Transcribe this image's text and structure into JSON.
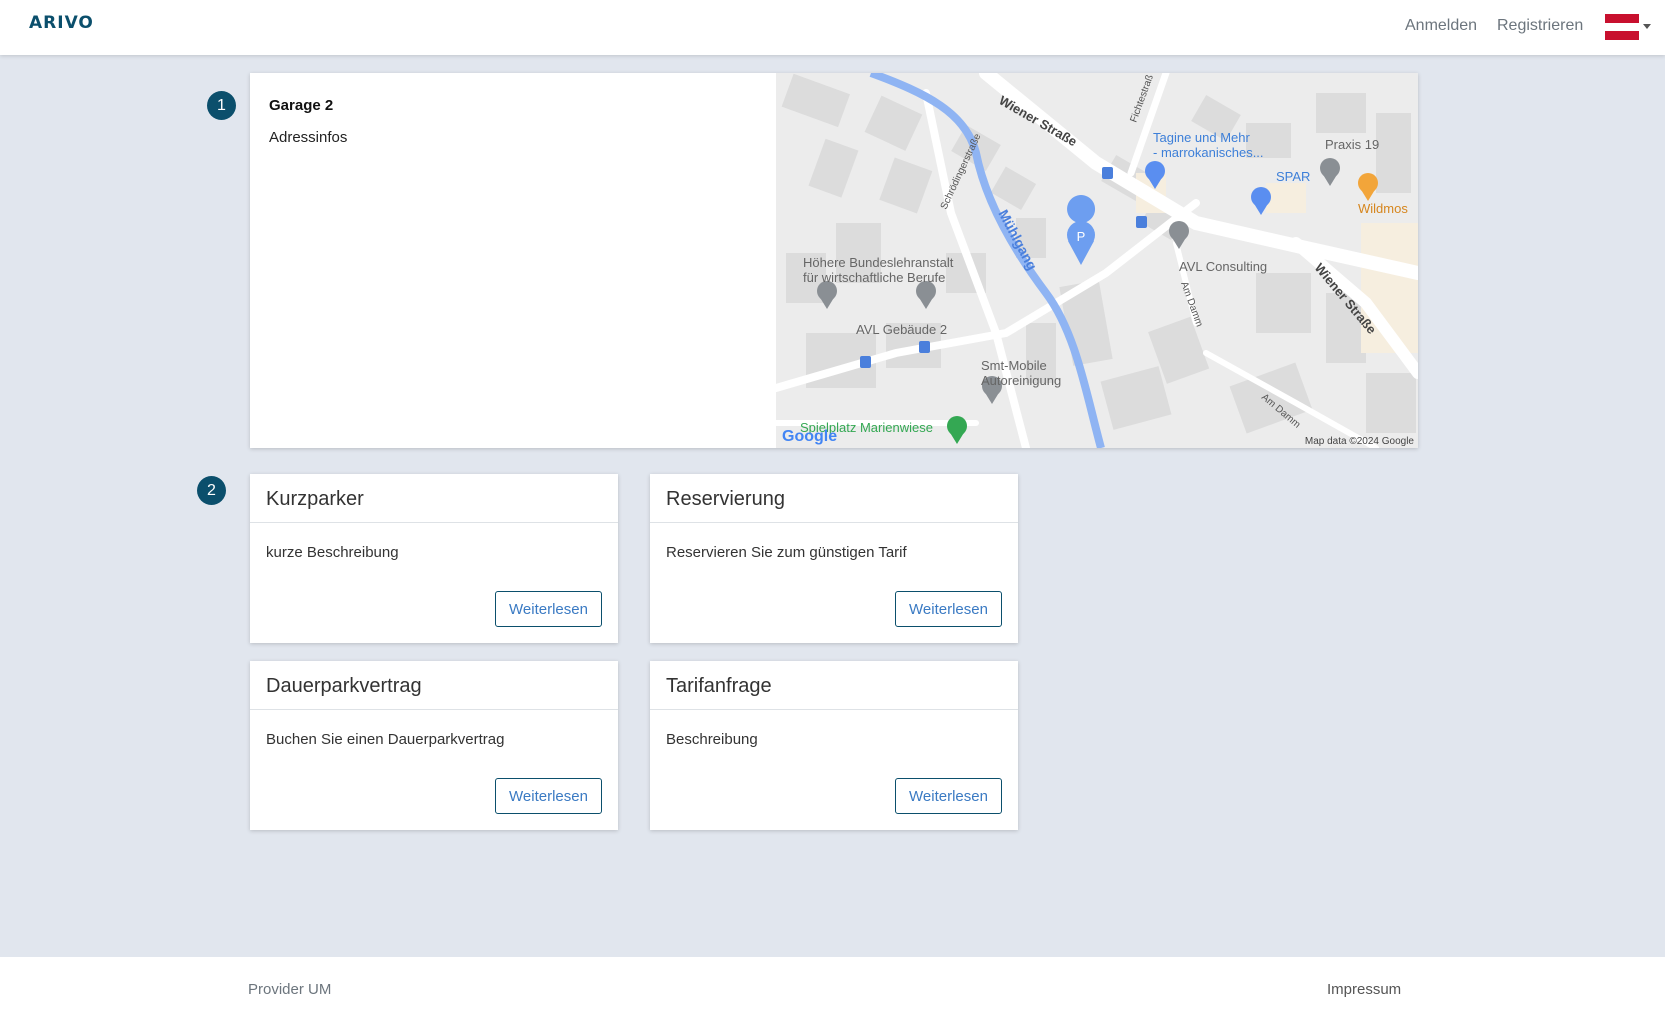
{
  "navbar": {
    "logo": "ARIVO",
    "login": "Anmelden",
    "register": "Registrieren",
    "language_flag_colors": [
      "#c8102e",
      "#ffffff",
      "#c8102e"
    ]
  },
  "steps": [
    "1",
    "2"
  ],
  "garage": {
    "name": "Garage 2",
    "address": "Adressinfos"
  },
  "map": {
    "labels": {
      "wiener_strasse": "Wiener Straße",
      "fichtestrasse": "Fichtestraß",
      "schroedinger": "Schrödingerstraße",
      "muehlgang": "Mühlgang",
      "tagine1": "Tagine und Mehr",
      "tagine2": "- marrokanisches...",
      "praxis": "Praxis 19",
      "spar": "SPAR",
      "wildmos": "Wildmos",
      "avl_consulting": "AVL Consulting",
      "hblfa1": "Höhere Bundeslehranstalt",
      "hblfa2": "für wirtschaftliche Berufe",
      "avl_gebaeude": "AVL Gebäude 2",
      "smt1": "Smt-Mobile",
      "smt2": "Autoreinigung",
      "am_damm": "Am Damm",
      "spielplatz": "Spielplatz Marienwiese",
      "google": "Google",
      "map_data": "Map data ©2024 Google",
      "parking": "P"
    }
  },
  "services": [
    {
      "title": "Kurzparker",
      "description": "kurze Beschreibung",
      "button": "Weiterlesen"
    },
    {
      "title": "Reservierung",
      "description": "Reservieren Sie zum günstigen Tarif",
      "button": "Weiterlesen"
    },
    {
      "title": "Dauerparkvertrag",
      "description": "Buchen Sie einen Dauerparkvertrag",
      "button": "Weiterlesen"
    },
    {
      "title": "Tarifanfrage",
      "description": "Beschreibung",
      "button": "Weiterlesen"
    }
  ],
  "footer": {
    "provider": "Provider UM",
    "imprint": "Impressum"
  },
  "colors": {
    "brand": "#0b4f6c",
    "background": "#e1e6ee",
    "link": "#3a7ac3"
  }
}
